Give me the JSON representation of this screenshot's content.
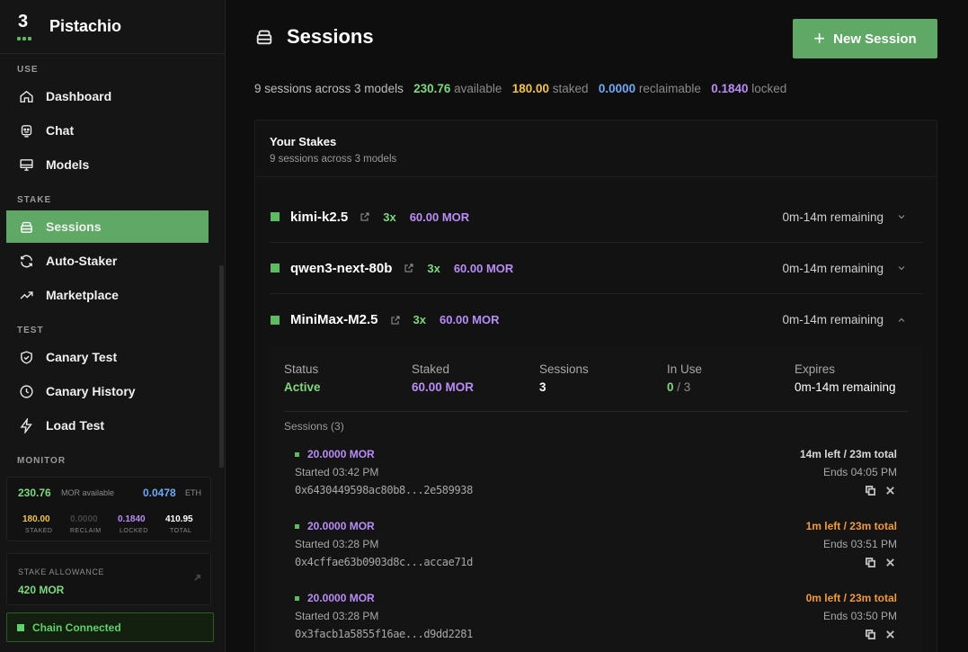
{
  "brand": {
    "logo_text": "3",
    "name": "Pistachio"
  },
  "nav": {
    "sections": [
      "USE",
      "STAKE",
      "TEST",
      "MONITOR"
    ],
    "items": [
      {
        "label": "Dashboard",
        "icon": "home-icon"
      },
      {
        "label": "Chat",
        "icon": "chat-bot-icon"
      },
      {
        "label": "Models",
        "icon": "monitor-icon"
      },
      {
        "label": "Sessions",
        "icon": "database-icon",
        "active": true
      },
      {
        "label": "Auto-Staker",
        "icon": "refresh-icon"
      },
      {
        "label": "Marketplace",
        "icon": "trending-up-icon"
      },
      {
        "label": "Canary Test",
        "icon": "shield-check-icon"
      },
      {
        "label": "Canary History",
        "icon": "clock-icon"
      },
      {
        "label": "Load Test",
        "icon": "lightning-icon"
      }
    ]
  },
  "monitor": {
    "mor_value": "230.76",
    "mor_label": "MOR available",
    "eth_value": "0.0478",
    "eth_label": "ETH",
    "stats": [
      {
        "value": "180.00",
        "label": "STAKED",
        "color": "#f2c24a"
      },
      {
        "value": "0.0000",
        "label": "RECLAIM",
        "color": "#4a4a4a"
      },
      {
        "value": "0.1840",
        "label": "LOCKED",
        "color": "#b98cf7"
      },
      {
        "value": "410.95",
        "label": "TOTAL",
        "color": "#ffffff"
      }
    ]
  },
  "allowance": {
    "label": "STAKE ALLOWANCE",
    "value": "420 MOR"
  },
  "chain": {
    "label": "Chain Connected"
  },
  "page": {
    "title": "Sessions",
    "new_button": "New Session"
  },
  "summary": {
    "prefix": "9 sessions across 3 models",
    "available_value": "230.76",
    "available_label": "available",
    "staked_value": "180.00",
    "staked_label": "staked",
    "reclaimable_value": "0.0000",
    "reclaimable_label": "reclaimable",
    "locked_value": "0.1840",
    "locked_label": "locked"
  },
  "stakes": {
    "title": "Your Stakes",
    "subtitle": "9 sessions across 3 models",
    "models": [
      {
        "name": "kimi-k2.5",
        "multiplier": "3x",
        "amount": "60.00 MOR",
        "remaining": "0m-14m remaining",
        "expanded": false
      },
      {
        "name": "qwen3-next-80b",
        "multiplier": "3x",
        "amount": "60.00 MOR",
        "remaining": "0m-14m remaining",
        "expanded": false
      },
      {
        "name": "MiniMax-M2.5",
        "multiplier": "3x",
        "amount": "60.00 MOR",
        "remaining": "0m-14m remaining",
        "expanded": true
      }
    ]
  },
  "detail": {
    "status_label": "Status",
    "status_value": "Active",
    "staked_label": "Staked",
    "staked_value": "60.00 MOR",
    "sessions_label": "Sessions",
    "sessions_value": "3",
    "inuse_label": "In Use",
    "inuse_value": "0",
    "inuse_total": "/ 3",
    "expires_label": "Expires",
    "expires_value": "0m-14m remaining",
    "sessions_header": "Sessions (3)",
    "sessions": [
      {
        "amount": "20.0000 MOR",
        "started": "Started 03:42 PM",
        "address": "0x6430449598ac80b8...2e589938",
        "left": "14m left / 23m total",
        "left_color": "#d8d8d8",
        "ends": "Ends 04:05 PM"
      },
      {
        "amount": "20.0000 MOR",
        "started": "Started 03:28 PM",
        "address": "0x4cffae63b0903d8c...accae71d",
        "left": "1m left / 23m total",
        "left_color": "#f29a3a",
        "ends": "Ends 03:51 PM"
      },
      {
        "amount": "20.0000 MOR",
        "started": "Started 03:28 PM",
        "address": "0x3facb1a5855f16ae...d9dd2281",
        "left": "0m left / 23m total",
        "left_color": "#f29a3a",
        "ends": "Ends 03:50 PM"
      }
    ]
  }
}
